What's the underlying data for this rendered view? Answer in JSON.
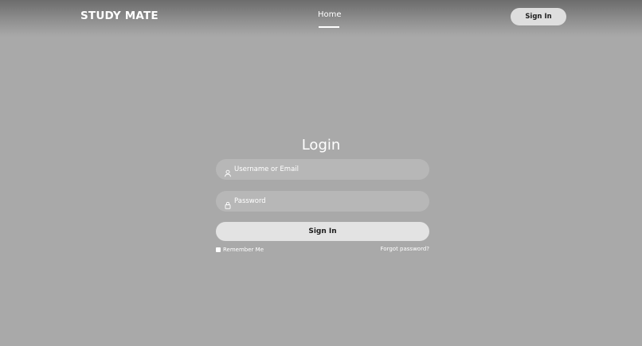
{
  "header": {
    "brand": "STUDY MATE",
    "nav": {
      "home_label": "Home"
    },
    "signin_label": "Sign In"
  },
  "login": {
    "title": "Login",
    "username": {
      "placeholder": "Username or Email",
      "value": "",
      "icon": "user-icon"
    },
    "password": {
      "placeholder": "Password",
      "value": "",
      "icon": "lock-icon"
    },
    "submit_label": "Sign In",
    "remember_label": "Remember Me",
    "forgot_label": "Forgot password?"
  },
  "colors": {
    "background": "#a9a9a9",
    "field": "#b7b7b7",
    "button": "#e3e3e3",
    "text": "#ffffff"
  }
}
